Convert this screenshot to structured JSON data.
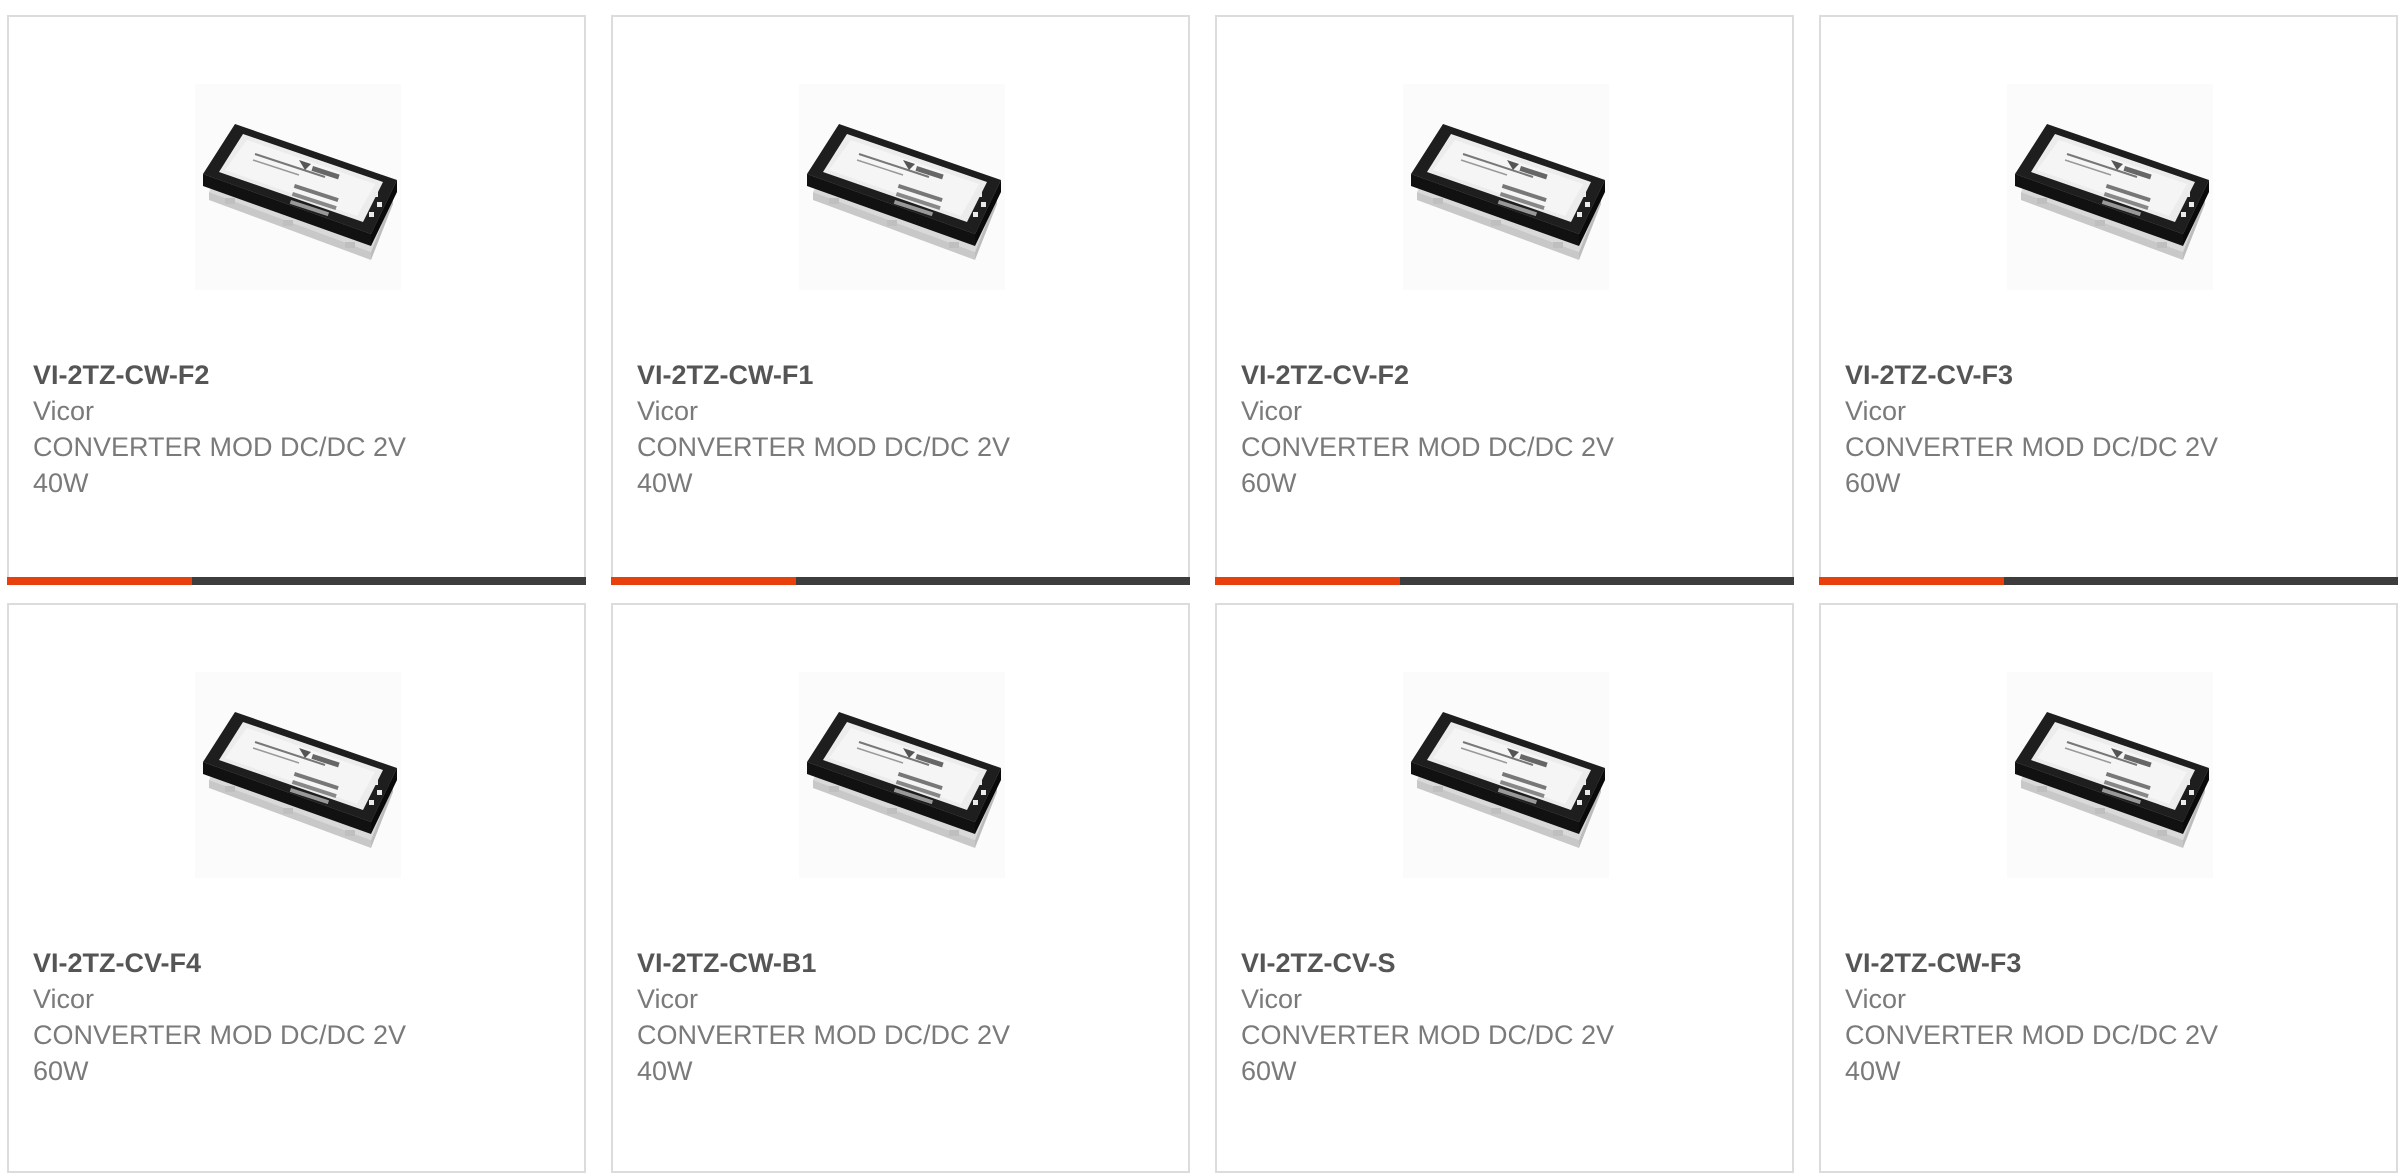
{
  "colors": {
    "accent": "#e8400c",
    "bar_track": "#3d3d3d",
    "card_border": "#dcdcdc",
    "title_text": "#555555",
    "body_text": "#7a7a7a"
  },
  "icons": {
    "product_image": "dc-dc-converter-module-image"
  },
  "products": [
    {
      "part_number": "VI-2TZ-CW-F2",
      "manufacturer": "Vicor",
      "description": "CONVERTER MOD DC/DC 2V 40W",
      "progress": 0.32
    },
    {
      "part_number": "VI-2TZ-CW-F1",
      "manufacturer": "Vicor",
      "description": "CONVERTER MOD DC/DC 2V 40W",
      "progress": 0.32
    },
    {
      "part_number": "VI-2TZ-CV-F2",
      "manufacturer": "Vicor",
      "description": "CONVERTER MOD DC/DC 2V 60W",
      "progress": 0.32
    },
    {
      "part_number": "VI-2TZ-CV-F3",
      "manufacturer": "Vicor",
      "description": "CONVERTER MOD DC/DC 2V 60W",
      "progress": 0.32
    },
    {
      "part_number": "VI-2TZ-CV-F4",
      "manufacturer": "Vicor",
      "description": "CONVERTER MOD DC/DC 2V 60W"
    },
    {
      "part_number": "VI-2TZ-CW-B1",
      "manufacturer": "Vicor",
      "description": "CONVERTER MOD DC/DC 2V 40W"
    },
    {
      "part_number": "VI-2TZ-CV-S",
      "manufacturer": "Vicor",
      "description": "CONVERTER MOD DC/DC 2V 60W"
    },
    {
      "part_number": "VI-2TZ-CW-F3",
      "manufacturer": "Vicor",
      "description": "CONVERTER MOD DC/DC 2V 40W"
    }
  ]
}
